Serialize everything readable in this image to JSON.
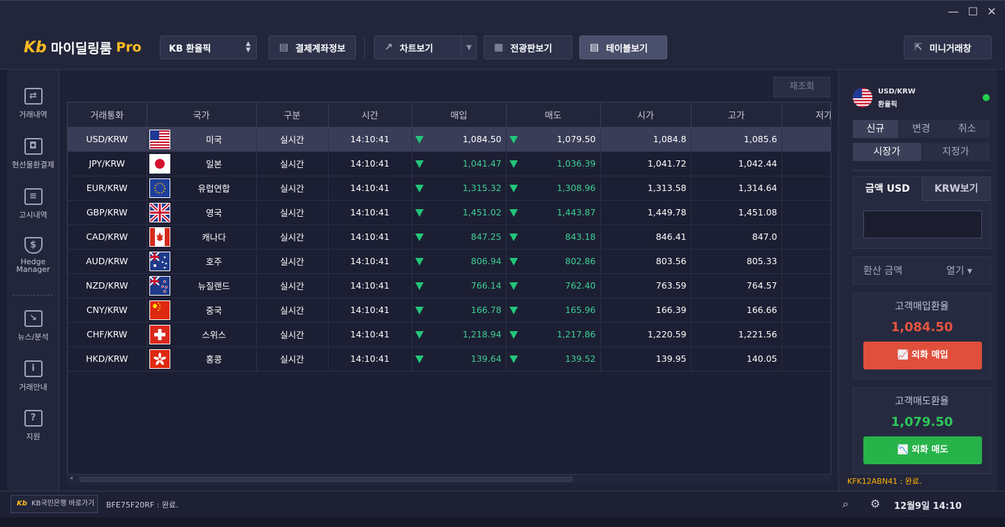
{
  "window": {
    "controls": [
      "—",
      "☐",
      "✕"
    ]
  },
  "header": {
    "logo_mark": "Kb",
    "logo_text": "마이딜링룸",
    "logo_pro": "Pro",
    "bank_select": "KB 환율픽",
    "account_info_label": "결제계좌정보",
    "chart_view_label": "차트보기",
    "board_view_label": "전광판보기",
    "table_view_label": "테이블보기",
    "mini_trade_label": "미니거래창"
  },
  "sidebar": {
    "items": [
      {
        "label": "거래내역",
        "icon": "exchange-icon"
      },
      {
        "label": "현선물환결제",
        "icon": "cash-icon"
      },
      {
        "label": "고시내역",
        "icon": "notice-icon"
      },
      {
        "label": "Hedge\nManager",
        "icon": "shield-dollar-icon"
      },
      {
        "label": "뉴스/분석",
        "icon": "chart-board-icon"
      },
      {
        "label": "거래안내",
        "icon": "info-icon"
      },
      {
        "label": "지원",
        "icon": "help-icon"
      }
    ]
  },
  "main": {
    "refresh_label": "재조회",
    "columns": [
      "거래통화",
      "국가",
      "구분",
      "시간",
      "매입",
      "매도",
      "시가",
      "고가",
      "저가"
    ],
    "rows": [
      {
        "pair": "USD/KRW",
        "flag": "us",
        "country": "미국",
        "type": "실시간",
        "time": "14:10:41",
        "buy": "1,084.50",
        "sell": "1,079.50",
        "open": "1,084.8",
        "high": "1,085.6"
      },
      {
        "pair": "JPY/KRW",
        "flag": "jp",
        "country": "일본",
        "type": "실시간",
        "time": "14:10:41",
        "buy": "1,041.47",
        "sell": "1,036.39",
        "open": "1,041.72",
        "high": "1,042.44"
      },
      {
        "pair": "EUR/KRW",
        "flag": "eu",
        "country": "유럽연합",
        "type": "실시간",
        "time": "14:10:41",
        "buy": "1,315.32",
        "sell": "1,308.96",
        "open": "1,313.58",
        "high": "1,314.64"
      },
      {
        "pair": "GBP/KRW",
        "flag": "gb",
        "country": "영국",
        "type": "실시간",
        "time": "14:10:41",
        "buy": "1,451.02",
        "sell": "1,443.87",
        "open": "1,449.78",
        "high": "1,451.08"
      },
      {
        "pair": "CAD/KRW",
        "flag": "ca",
        "country": "캐나다",
        "type": "실시간",
        "time": "14:10:41",
        "buy": "847.25",
        "sell": "843.18",
        "open": "846.41",
        "high": "847.0"
      },
      {
        "pair": "AUD/KRW",
        "flag": "au",
        "country": "호주",
        "type": "실시간",
        "time": "14:10:41",
        "buy": "806.94",
        "sell": "802.86",
        "open": "803.56",
        "high": "805.33"
      },
      {
        "pair": "NZD/KRW",
        "flag": "nz",
        "country": "뉴질랜드",
        "type": "실시간",
        "time": "14:10:41",
        "buy": "766.14",
        "sell": "762.40",
        "open": "763.59",
        "high": "764.57"
      },
      {
        "pair": "CNY/KRW",
        "flag": "cn",
        "country": "중국",
        "type": "실시간",
        "time": "14:10:41",
        "buy": "166.78",
        "sell": "165.96",
        "open": "166.39",
        "high": "166.66"
      },
      {
        "pair": "CHF/KRW",
        "flag": "ch",
        "country": "스위스",
        "type": "실시간",
        "time": "14:10:41",
        "buy": "1,218.94",
        "sell": "1,217.86",
        "open": "1,220.59",
        "high": "1,221.56"
      },
      {
        "pair": "HKD/KRW",
        "flag": "hk",
        "country": "홍콩",
        "type": "실시간",
        "time": "14:10:41",
        "buy": "139.64",
        "sell": "139.52",
        "open": "139.95",
        "high": "140.05"
      }
    ]
  },
  "panel": {
    "pair": "USD/KRW",
    "pair_sub": "환율픽",
    "order_tabs": [
      "신규",
      "변경",
      "취소"
    ],
    "price_tabs": [
      "시장가",
      "지정가"
    ],
    "amount_tab": "금액 USD",
    "krw_tab": "KRW보기",
    "conversion_label": "환산 금액",
    "conversion_toggle": "열기 ▾",
    "buy_rate_title": "고객매입환율",
    "buy_rate": "1,084.50",
    "buy_button": "외화 매입",
    "sell_rate_title": "고객매도환율",
    "sell_rate": "1,079.50",
    "sell_button": "외화 매도",
    "status": "KFK12ABN41 : 완료."
  },
  "footer": {
    "bank_link_mark": "Kb",
    "bank_link": "KB국민은행 바로가기",
    "status": "BFE75F20RF : 완료.",
    "clock": "12월9일 14:10"
  },
  "colors": {
    "accent_yellow": "#ffbc1f",
    "up_green": "#3fd094",
    "buy_red": "#e04f3b",
    "sell_green": "#27b34a"
  }
}
